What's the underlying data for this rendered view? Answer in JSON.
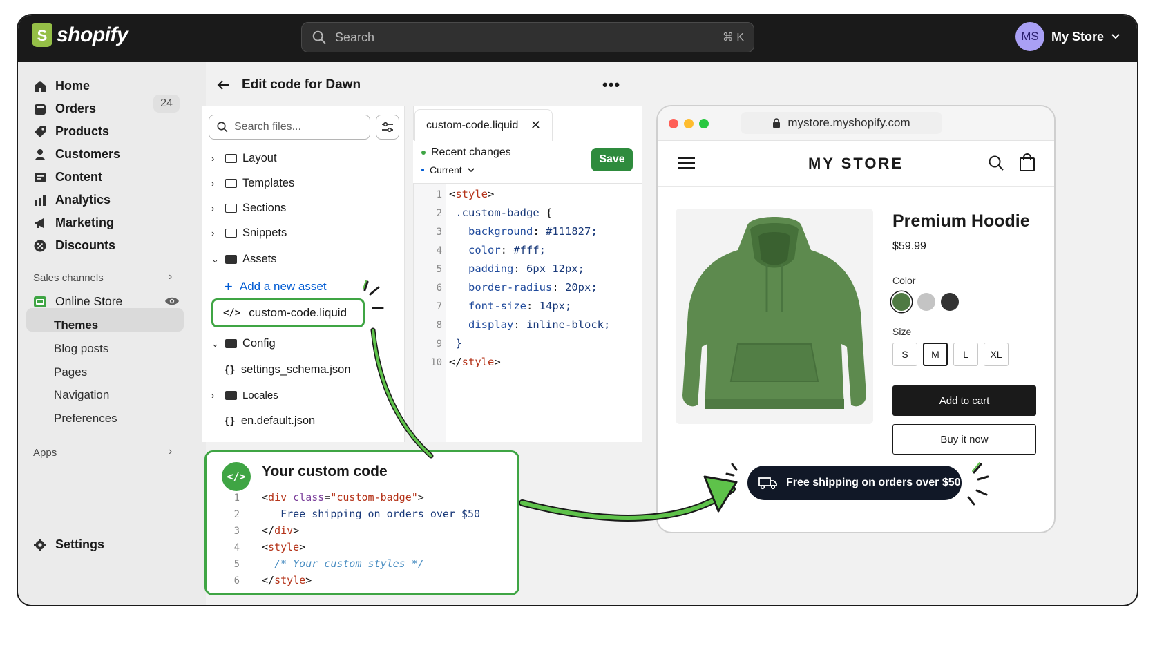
{
  "topbar": {
    "logo_text": "shopify",
    "search_placeholder": "Search",
    "search_shortcut": "⌘ K",
    "avatar_initials": "MS",
    "store_name": "My Store"
  },
  "sidebar": {
    "items": [
      {
        "label": "Home",
        "icon": "home-icon"
      },
      {
        "label": "Orders",
        "icon": "orders-icon",
        "badge": "24"
      },
      {
        "label": "Products",
        "icon": "tag-icon"
      },
      {
        "label": "Customers",
        "icon": "person-icon"
      },
      {
        "label": "Content",
        "icon": "content-icon"
      },
      {
        "label": "Analytics",
        "icon": "bar-chart-icon"
      },
      {
        "label": "Marketing",
        "icon": "megaphone-icon"
      },
      {
        "label": "Discounts",
        "icon": "discount-icon"
      }
    ],
    "sales_channels_label": "Sales channels",
    "online_store_label": "Online Store",
    "online_store_sub": [
      "Themes",
      "Blog posts",
      "Pages",
      "Navigation",
      "Preferences"
    ],
    "apps_label": "Apps",
    "settings_label": "Settings"
  },
  "editor": {
    "title": "Edit code for Dawn",
    "file_search_placeholder": "Search files...",
    "tree": {
      "layout": "Layout",
      "templates": "Templates",
      "sections": "Sections",
      "snippets": "Snippets",
      "assets": "Assets",
      "add_asset": "Add a new asset",
      "active_file": "custom-code.liquid",
      "config": "Config",
      "settings_schema": "settings_schema.json",
      "locales": "Locales",
      "en_default": "en.default.json"
    },
    "tab_label": "custom-code.liquid",
    "recent_changes": "Recent changes",
    "current_label": "Current",
    "save_label": "Save",
    "code_lines": [
      "<style>",
      " .custom-badge {",
      "   background: #111827;",
      "   color: #fff;",
      "   padding: 6px 12px;",
      "   border-radius: 20px;",
      "   font-size: 14px;",
      "   display: inline-block;",
      " }",
      "</style>"
    ]
  },
  "callout": {
    "title": "Your custom code",
    "lines": [
      "<div class=\"custom-badge\">",
      "   Free shipping on orders over $50",
      "</div>",
      "<style>",
      "  /* Your custom styles */",
      "</style>"
    ]
  },
  "preview": {
    "url": "mystore.myshopify.com",
    "store_title": "MY STORE",
    "product_title": "Premium Hoodie",
    "price": "$59.99",
    "color_label": "Color",
    "colors": [
      "#4f7a43",
      "#c4c4c4",
      "#333333"
    ],
    "size_label": "Size",
    "sizes": [
      "S",
      "M",
      "L",
      "XL"
    ],
    "selected_size": "M",
    "add_to_cart": "Add to cart",
    "buy_now": "Buy it now",
    "badge_text": "Free shipping on orders over $50"
  },
  "colors": {
    "brand_green": "#95bf47",
    "accent_green": "#3fa544",
    "save_green": "#2e8b3d",
    "badge_dark": "#111827",
    "topbar": "#1a1a1a"
  }
}
